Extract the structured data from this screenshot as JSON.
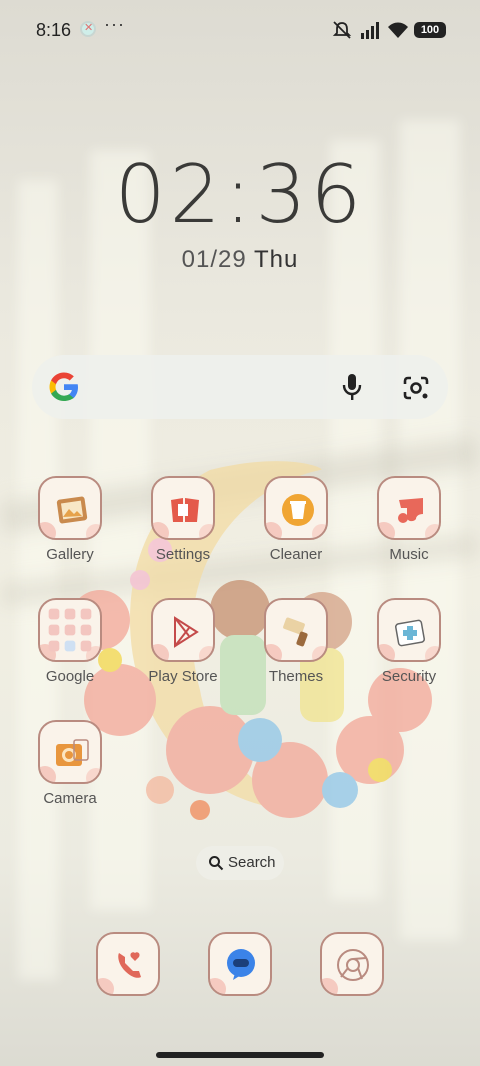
{
  "status_bar": {
    "time": "8:16",
    "more_indicator": "···",
    "battery_level": "100",
    "icons": [
      "notification-icon",
      "mute-icon",
      "signal-icon",
      "wifi-icon",
      "battery-icon"
    ]
  },
  "clock": {
    "time": "02:36",
    "date": "01/29",
    "day": "Thu"
  },
  "search_widget": {
    "icons": [
      "google-logo-icon",
      "microphone-icon",
      "lens-icon"
    ]
  },
  "apps": [
    {
      "label": "Gallery",
      "icon": "gallery-icon"
    },
    {
      "label": "Settings",
      "icon": "settings-icon"
    },
    {
      "label": "Cleaner",
      "icon": "cleaner-icon"
    },
    {
      "label": "Music",
      "icon": "music-icon"
    },
    {
      "label": "Google",
      "icon": "google-folder-icon"
    },
    {
      "label": "Play Store",
      "icon": "play-store-icon"
    },
    {
      "label": "Themes",
      "icon": "themes-icon"
    },
    {
      "label": "Security",
      "icon": "security-icon"
    },
    {
      "label": "Camera",
      "icon": "camera-icon"
    }
  ],
  "app_search": {
    "label": "Search"
  },
  "dock": [
    {
      "icon": "phone-icon"
    },
    {
      "icon": "messages-icon"
    },
    {
      "icon": "chrome-icon"
    }
  ],
  "colors": {
    "tile_border": "#b98b80",
    "tile_bg": "#faf3ea",
    "accent_orange": "#e8a24a",
    "accent_red": "#e06a58",
    "accent_blue": "#3b83e8"
  }
}
